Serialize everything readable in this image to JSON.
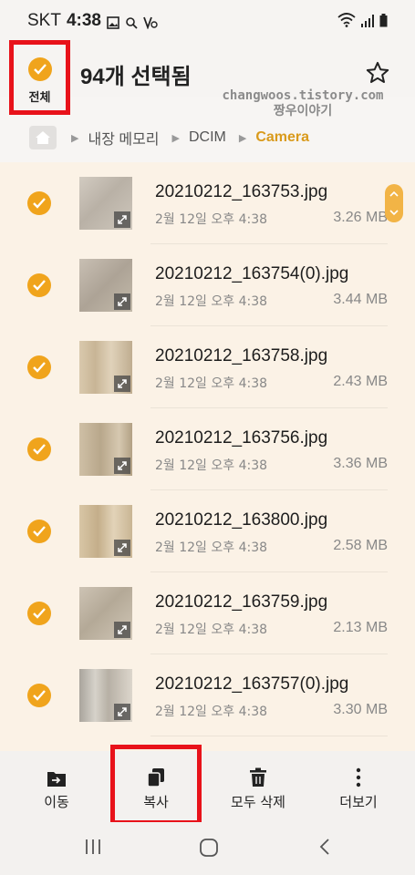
{
  "status_bar": {
    "carrier": "SKT",
    "time": "4:38"
  },
  "header": {
    "select_all_label": "전체",
    "title": "94개 선택됨"
  },
  "watermark": {
    "line1": "changwoos.tistory.com",
    "line2": "짱우이야기"
  },
  "breadcrumb": {
    "items": [
      "내장 메모리",
      "DCIM",
      "Camera"
    ]
  },
  "files": [
    {
      "name": "20210212_163753.jpg",
      "date": "2월 12일 오후 4:38",
      "size": "3.26 MB"
    },
    {
      "name": "20210212_163754(0).jpg",
      "date": "2월 12일 오후 4:38",
      "size": "3.44 MB"
    },
    {
      "name": "20210212_163758.jpg",
      "date": "2월 12일 오후 4:38",
      "size": "2.43 MB"
    },
    {
      "name": "20210212_163756.jpg",
      "date": "2월 12일 오후 4:38",
      "size": "3.36 MB"
    },
    {
      "name": "20210212_163800.jpg",
      "date": "2월 12일 오후 4:38",
      "size": "2.58 MB"
    },
    {
      "name": "20210212_163759.jpg",
      "date": "2월 12일 오후 4:38",
      "size": "2.13 MB"
    },
    {
      "name": "20210212_163757(0).jpg",
      "date": "2월 12일 오후 4:38",
      "size": "3.30 MB"
    }
  ],
  "toolbar": {
    "move_label": "이동",
    "copy_label": "복사",
    "delete_all_label": "모두 삭제",
    "more_label": "더보기"
  },
  "colors": {
    "accent": "#f0a41c",
    "highlight_frame": "#e8121a",
    "breadcrumb_current": "#d99a1b"
  }
}
